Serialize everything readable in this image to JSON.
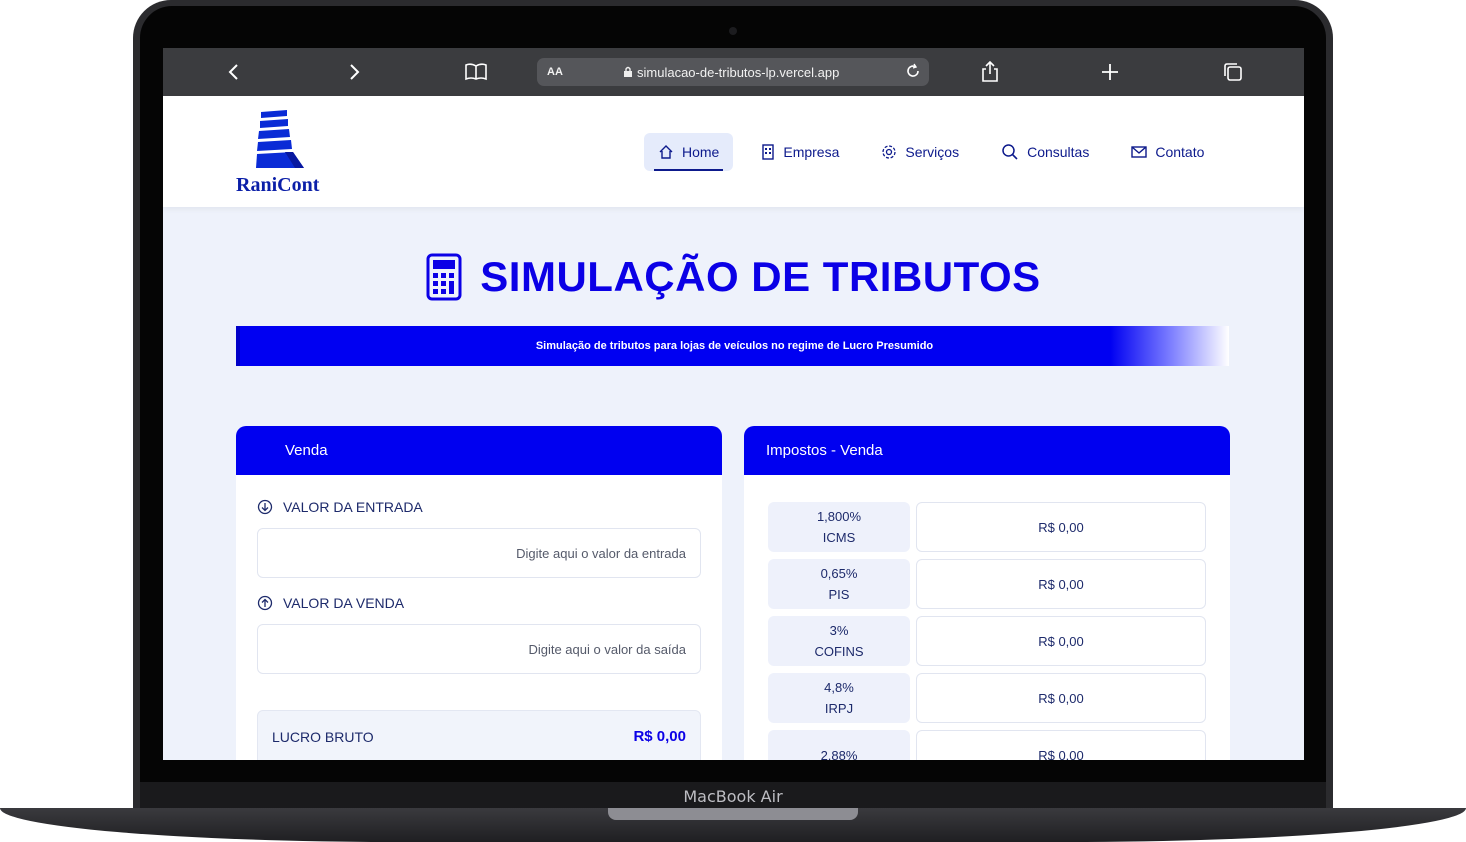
{
  "device": {
    "label": "MacBook Air"
  },
  "browser": {
    "aa_label": "AA",
    "url": "simulacao-de-tributos-lp.vercel.app"
  },
  "site": {
    "logo_text": "RaniCont",
    "nav": [
      {
        "label": "Home",
        "icon": "home-icon",
        "active": true
      },
      {
        "label": "Empresa",
        "icon": "building-icon",
        "active": false
      },
      {
        "label": "Serviços",
        "icon": "gear-icon",
        "active": false
      },
      {
        "label": "Consultas",
        "icon": "search-icon",
        "active": false
      },
      {
        "label": "Contato",
        "icon": "mail-icon",
        "active": false
      }
    ]
  },
  "main": {
    "title": "SIMULAÇÃO DE TRIBUTOS",
    "banner": "Simulação de tributos para lojas de veículos no regime de Lucro Presumido"
  },
  "venda": {
    "header": "Venda",
    "entrada_label": "VALOR DA ENTRADA",
    "entrada_placeholder": "Digite aqui o valor da entrada",
    "venda_label": "VALOR DA VENDA",
    "venda_placeholder": "Digite aqui o valor da saída",
    "lucro_label": "LUCRO BRUTO",
    "lucro_value": "R$ 0,00"
  },
  "impostos": {
    "header": "Impostos - Venda",
    "rows": [
      {
        "rate": "1,800%",
        "name": "ICMS",
        "value": "R$ 0,00"
      },
      {
        "rate": "0,65%",
        "name": "PIS",
        "value": "R$ 0,00"
      },
      {
        "rate": "3%",
        "name": "COFINS",
        "value": "R$ 0,00"
      },
      {
        "rate": "4,8%",
        "name": "IRPJ",
        "value": "R$ 0,00"
      },
      {
        "rate": "2,88%",
        "name": "",
        "value": "R$ 0,00"
      }
    ]
  },
  "colors": {
    "accent": "#0000f0",
    "navy": "#0d1a8c",
    "page_bg": "#eef2fb"
  }
}
